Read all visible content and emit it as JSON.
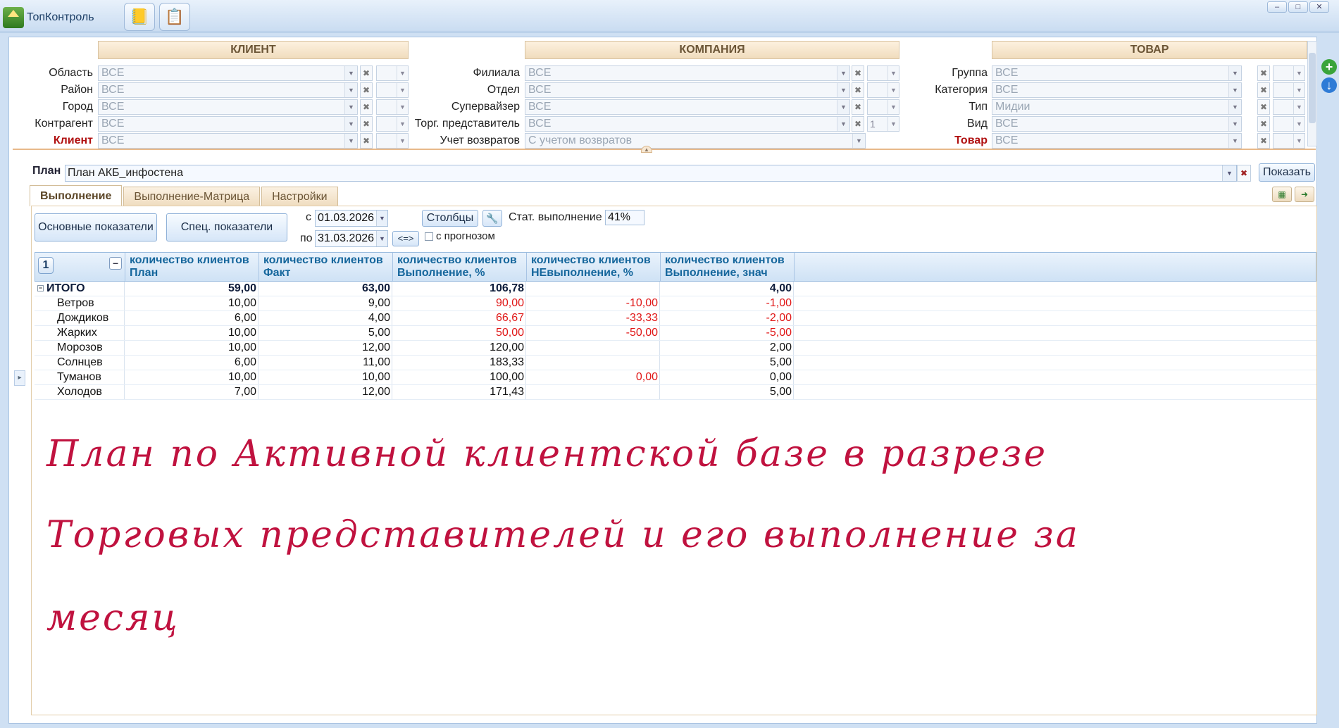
{
  "app": {
    "title": "ТопКонтроль"
  },
  "sections": {
    "client": "КЛИЕНТ",
    "company": "КОМПАНИЯ",
    "product": "ТОВАР"
  },
  "filters": {
    "client": [
      {
        "label": "Область",
        "value": "ВСЕ"
      },
      {
        "label": "Район",
        "value": "ВСЕ"
      },
      {
        "label": "Город",
        "value": "ВСЕ"
      },
      {
        "label": "Контрагент",
        "value": "ВСЕ"
      },
      {
        "label": "Клиент",
        "value": "ВСЕ"
      }
    ],
    "company": [
      {
        "label": "Филиала",
        "value": "ВСЕ"
      },
      {
        "label": "Отдел",
        "value": "ВСЕ"
      },
      {
        "label": "Супервайзер",
        "value": "ВСЕ"
      },
      {
        "label": "Торг. представитель",
        "value": "ВСЕ",
        "extra": "1"
      },
      {
        "label": "Учет возвратов",
        "value": "С учетом возвратов"
      }
    ],
    "product": [
      {
        "label": "Группа",
        "value": "ВСЕ"
      },
      {
        "label": "Категория",
        "value": "ВСЕ"
      },
      {
        "label": "Тип",
        "value": "Мидии"
      },
      {
        "label": "Вид",
        "value": "ВСЕ"
      },
      {
        "label": "Товар",
        "value": "ВСЕ"
      }
    ]
  },
  "plan": {
    "label": "План",
    "value": "План АКБ_инфостена",
    "show_button": "Показать"
  },
  "tabs": [
    "Выполнение",
    "Выполнение-Матрица",
    "Настройки"
  ],
  "toolbar": {
    "main_indicators": "Основные показатели",
    "special_indicators": "Спец. показатели",
    "from_label": "с",
    "to_label": "по",
    "date_from": "01.03.2026",
    "date_to": "31.03.2026",
    "swap": "<=>",
    "columns": "Столбцы",
    "stat_label": "Стат. выполнение",
    "stat_value": "41%",
    "forecast_label": "с прогнозом"
  },
  "grid": {
    "level_badge": "1",
    "columns": [
      {
        "line1": "количество клиентов",
        "line2": "План"
      },
      {
        "line1": "количество клиентов",
        "line2": "Факт"
      },
      {
        "line1": "количество клиентов",
        "line2": "Выполнение, %"
      },
      {
        "line1": "количество клиентов",
        "line2": "НЕвыполнение, %"
      },
      {
        "line1": "количество клиентов",
        "line2": "Выполнение, знач"
      }
    ],
    "total": {
      "name": "ИТОГО",
      "plan": "59,00",
      "fact": "63,00",
      "pct": "106,78",
      "notpct": "",
      "diff": "4,00"
    },
    "rows": [
      {
        "name": "Ветров",
        "plan": "10,00",
        "fact": "9,00",
        "pct": "90,00",
        "notpct": "-10,00",
        "diff": "-1,00",
        "neg": true
      },
      {
        "name": "Дождиков",
        "plan": "6,00",
        "fact": "4,00",
        "pct": "66,67",
        "notpct": "-33,33",
        "diff": "-2,00",
        "neg": true
      },
      {
        "name": "Жарких",
        "plan": "10,00",
        "fact": "5,00",
        "pct": "50,00",
        "notpct": "-50,00",
        "diff": "-5,00",
        "neg": true
      },
      {
        "name": "Морозов",
        "plan": "10,00",
        "fact": "12,00",
        "pct": "120,00",
        "notpct": "",
        "diff": "2,00",
        "neg": false
      },
      {
        "name": "Солнцев",
        "plan": "6,00",
        "fact": "11,00",
        "pct": "183,33",
        "notpct": "",
        "diff": "5,00",
        "neg": false
      },
      {
        "name": "Туманов",
        "plan": "10,00",
        "fact": "10,00",
        "pct": "100,00",
        "notpct": "0,00",
        "diff": "0,00",
        "neg": false,
        "notpct_red": true
      },
      {
        "name": "Холодов",
        "plan": "7,00",
        "fact": "12,00",
        "pct": "171,43",
        "notpct": "",
        "diff": "5,00",
        "neg": false
      }
    ]
  },
  "annotation": [
    "План по Активной клиентской базе в разрезе",
    "Торговых представителей и его выполнение за",
    "месяц"
  ],
  "colors": {
    "negative": "#e01616",
    "header_text": "#15669c",
    "annotation": "#c0123f"
  }
}
